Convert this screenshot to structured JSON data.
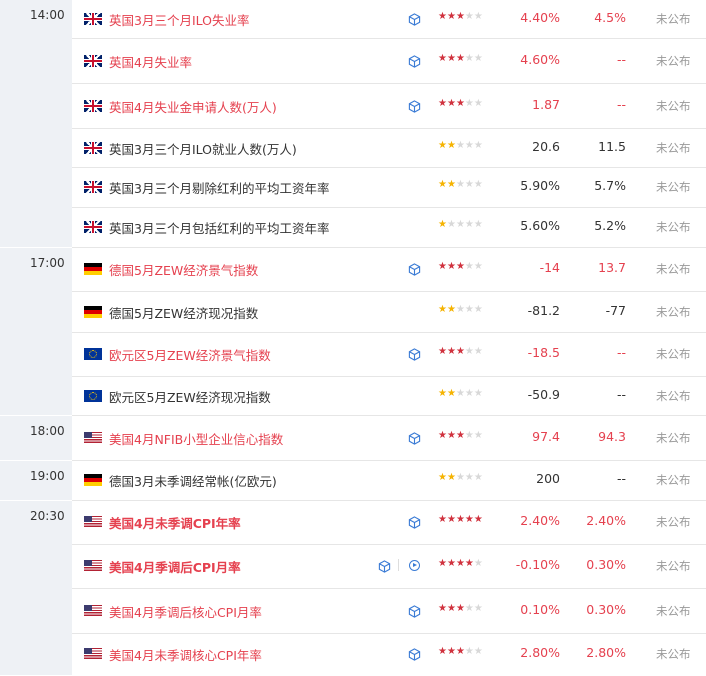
{
  "colors": {
    "highlight": "#e5414f",
    "time_bg": "#eef1f5",
    "muted": "#999999",
    "star_red": "#d0323e",
    "star_gold": "#f5b301"
  },
  "time_groups": [
    {
      "time": "14:00",
      "rows": 6
    },
    {
      "time": "17:00",
      "rows": 4
    },
    {
      "time": "18:00",
      "rows": 1
    },
    {
      "time": "19:00",
      "rows": 1
    },
    {
      "time": "20:30",
      "rows": 4
    }
  ],
  "rows": [
    {
      "flag": "uk",
      "name": "英国3月三个月ILO失业率",
      "highlight": true,
      "bold": false,
      "cube": true,
      "play": false,
      "stars": 3,
      "star_color": "red",
      "previous": "4.40%",
      "forecast": "4.5%",
      "forecast_dash": false,
      "status": "未公布"
    },
    {
      "flag": "uk",
      "name": "英国4月失业率",
      "highlight": true,
      "bold": false,
      "cube": true,
      "play": false,
      "stars": 3,
      "star_color": "red",
      "previous": "4.60%",
      "forecast": "--",
      "forecast_dash": true,
      "status": "未公布"
    },
    {
      "flag": "uk",
      "name": "英国4月失业金申请人数(万人)",
      "highlight": true,
      "bold": false,
      "cube": true,
      "play": false,
      "stars": 3,
      "star_color": "red",
      "previous": "1.87",
      "forecast": "--",
      "forecast_dash": true,
      "status": "未公布"
    },
    {
      "flag": "uk",
      "name": "英国3月三个月ILO就业人数(万人)",
      "highlight": false,
      "bold": false,
      "cube": false,
      "play": false,
      "stars": 2,
      "star_color": "gold",
      "previous": "20.6",
      "forecast": "11.5",
      "forecast_dash": false,
      "status": "未公布"
    },
    {
      "flag": "uk",
      "name": "英国3月三个月剔除红利的平均工资年率",
      "highlight": false,
      "bold": false,
      "cube": false,
      "play": false,
      "stars": 2,
      "star_color": "gold",
      "previous": "5.90%",
      "forecast": "5.7%",
      "forecast_dash": false,
      "status": "未公布"
    },
    {
      "flag": "uk",
      "name": "英国3月三个月包括红利的平均工资年率",
      "highlight": false,
      "bold": false,
      "cube": false,
      "play": false,
      "stars": 1,
      "star_color": "gold",
      "previous": "5.60%",
      "forecast": "5.2%",
      "forecast_dash": false,
      "status": "未公布"
    },
    {
      "flag": "de",
      "name": "德国5月ZEW经济景气指数",
      "highlight": true,
      "bold": false,
      "cube": true,
      "play": false,
      "stars": 3,
      "star_color": "red",
      "previous": "-14",
      "forecast": "13.7",
      "forecast_dash": false,
      "status": "未公布"
    },
    {
      "flag": "de",
      "name": "德国5月ZEW经济现况指数",
      "highlight": false,
      "bold": false,
      "cube": false,
      "play": false,
      "stars": 2,
      "star_color": "gold",
      "previous": "-81.2",
      "forecast": "-77",
      "forecast_dash": false,
      "status": "未公布"
    },
    {
      "flag": "eu",
      "name": "欧元区5月ZEW经济景气指数",
      "highlight": true,
      "bold": false,
      "cube": true,
      "play": false,
      "stars": 3,
      "star_color": "red",
      "previous": "-18.5",
      "forecast": "--",
      "forecast_dash": true,
      "status": "未公布"
    },
    {
      "flag": "eu",
      "name": "欧元区5月ZEW经济现况指数",
      "highlight": false,
      "bold": false,
      "cube": false,
      "play": false,
      "stars": 2,
      "star_color": "gold",
      "previous": "-50.9",
      "forecast": "--",
      "forecast_dash": false,
      "status": "未公布"
    },
    {
      "flag": "us",
      "name": "美国4月NFIB小型企业信心指数",
      "highlight": true,
      "bold": false,
      "cube": true,
      "play": false,
      "stars": 3,
      "star_color": "red",
      "previous": "97.4",
      "forecast": "94.3",
      "forecast_dash": false,
      "status": "未公布"
    },
    {
      "flag": "de",
      "name": "德国3月未季调经常帐(亿欧元)",
      "highlight": false,
      "bold": false,
      "cube": false,
      "play": false,
      "stars": 2,
      "star_color": "gold",
      "previous": "200",
      "forecast": "--",
      "forecast_dash": false,
      "status": "未公布"
    },
    {
      "flag": "us",
      "name": "美国4月未季调CPI年率",
      "highlight": true,
      "bold": true,
      "cube": true,
      "play": false,
      "stars": 5,
      "star_color": "red",
      "previous": "2.40%",
      "forecast": "2.40%",
      "forecast_dash": false,
      "status": "未公布"
    },
    {
      "flag": "us",
      "name": "美国4月季调后CPI月率",
      "highlight": true,
      "bold": true,
      "cube": true,
      "play": true,
      "stars": 4,
      "star_color": "red",
      "previous": "-0.10%",
      "forecast": "0.30%",
      "forecast_dash": false,
      "status": "未公布"
    },
    {
      "flag": "us",
      "name": "美国4月季调后核心CPI月率",
      "highlight": true,
      "bold": false,
      "cube": true,
      "play": false,
      "stars": 3,
      "star_color": "red",
      "previous": "0.10%",
      "forecast": "0.30%",
      "forecast_dash": false,
      "status": "未公布"
    },
    {
      "flag": "us",
      "name": "美国4月未季调核心CPI年率",
      "highlight": true,
      "bold": false,
      "cube": true,
      "play": false,
      "stars": 3,
      "star_color": "red",
      "previous": "2.80%",
      "forecast": "2.80%",
      "forecast_dash": false,
      "status": "未公布"
    }
  ]
}
